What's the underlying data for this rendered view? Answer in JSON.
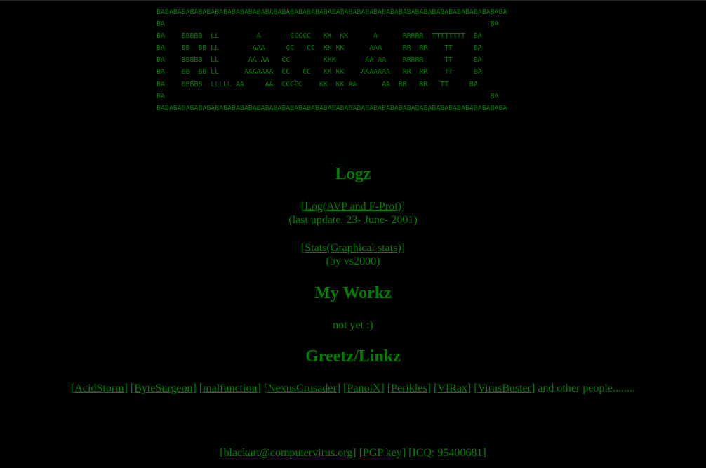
{
  "banner": {
    "lines": [
      "BABABABABABABABABABABABABABABABABABABABABABABABABABABABABABABABABABABABABABABABABABA",
      "BA                                                                              BA",
      "BA    BBBBB  LL         A       CCCCC   KK  KK      A      RRRRR  TTTTTTTT  BA",
      "BA    BB  BB LL        AAA     CC   CC  KK KK      AAA     RR  RR    TT     BA",
      "BA    BBBBB  LL       AA AA   CC        KKK       AA AA    RRRRR     TT     BA",
      "BA    BB  BB LL      AAAAAAA  CC   CC   KK KK    AAAAAAA   RR  RR    TT     BA",
      "BA    BBBBB  LLLLL AA     AA  CCCCC    KK  KK AA      AA  RR   RR   TT     BA",
      "BA                                                                              BA",
      "BABABABABABABABABABABABABABABABABABABABABABABABABABABABABABABABABABABABABABABABABABA"
    ]
  },
  "logz": {
    "heading": "Logz",
    "log_link": "Log(AVP and F-Prot)",
    "log_note": "(last update. 23- June- 2001)",
    "stats_link": "Stats(Graphical stats)",
    "stats_note": "(by vs2000)"
  },
  "workz": {
    "heading": "My Workz",
    "note": "not yet :)"
  },
  "greetz": {
    "heading": "Greetz/Linkz",
    "links": [
      "AcidStorm",
      "ByteSurgeon",
      "malfunction",
      "NexusCrusader",
      "PanoiX",
      "Perikles",
      "VIRax",
      "VirusBuster"
    ],
    "tail": "and other people........"
  },
  "footer": {
    "email": "blackart@computervirus.org",
    "pgp": "PGP key",
    "icq": "[ICQ: 95400681]"
  }
}
